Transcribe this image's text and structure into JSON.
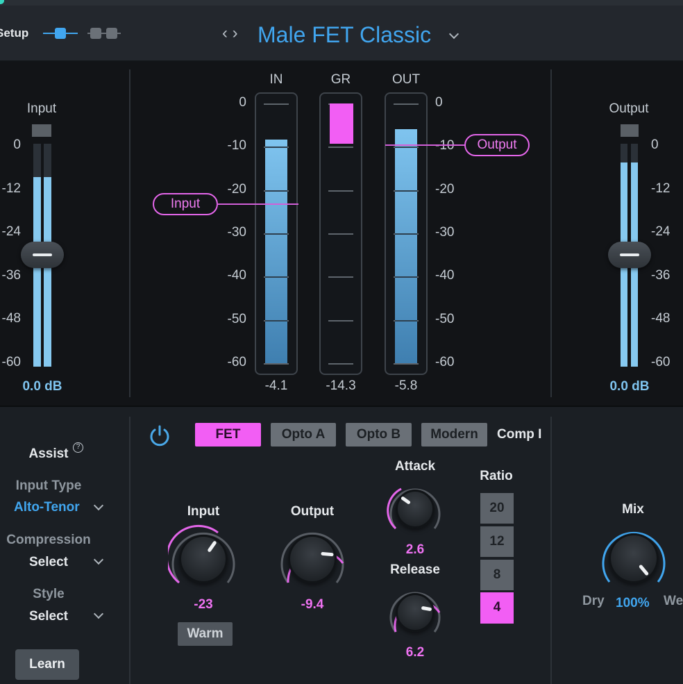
{
  "header": {
    "setup_label": "Setup",
    "nav_glyph": "‹ ›",
    "preset_name": "Male FET Classic",
    "icons": [
      "single-view-icon",
      "dual-view-icon",
      "chevron-down-icon"
    ]
  },
  "meters": {
    "input_fader": {
      "label": "Input",
      "value": "0.0 dB",
      "scale": [
        "0",
        "-12",
        "-24",
        "-36",
        "-48",
        "-60"
      ]
    },
    "output_fader": {
      "label": "Output",
      "value": "0.0 dB",
      "scale": [
        "0",
        "-12",
        "-24",
        "-36",
        "-48",
        "-60"
      ]
    },
    "columns": [
      {
        "label": "IN",
        "readout": "-4.1"
      },
      {
        "label": "GR",
        "readout": "-14.3"
      },
      {
        "label": "OUT",
        "readout": "-5.8"
      }
    ],
    "left_scale": [
      "0",
      "-10",
      "-20",
      "-30",
      "-40",
      "-50",
      "-60"
    ],
    "right_scale": [
      "0",
      "-10",
      "-20",
      "-30",
      "-40",
      "-50",
      "-60"
    ],
    "callouts": {
      "input": "Input",
      "output": "Output"
    },
    "levels": {
      "in": 0.86,
      "gr": 0.155,
      "out": 0.9,
      "input_fader": 0.85,
      "output_fader": 0.915
    },
    "colors": {
      "meter": "#7fc4ef",
      "accent": "#f25ef4",
      "brand": "#41a6ef"
    }
  },
  "assist": {
    "title": "Assist",
    "help_glyph": "?",
    "input_type_label": "Input Type",
    "input_type_value": "Alto-Tenor",
    "compression_label": "Compression",
    "compression_value": "Select",
    "style_label": "Style",
    "style_value": "Select",
    "learn_label": "Learn"
  },
  "comp": {
    "power_icon": "power-icon",
    "modes": [
      "FET",
      "Opto A",
      "Opto B",
      "Modern"
    ],
    "active_mode": "FET",
    "section_label": "Comp I",
    "input_label": "Input",
    "input_value": "-23",
    "warm_label": "Warm",
    "output_label": "Output",
    "output_value": "-9.4",
    "attack_label": "Attack",
    "attack_value": "2.6",
    "release_label": "Release",
    "release_value": "6.2",
    "ratio_label": "Ratio",
    "ratios": [
      "20",
      "12",
      "8",
      "4"
    ],
    "active_ratio": "4"
  },
  "mix": {
    "label": "Mix",
    "dry": "Dry",
    "value": "100%",
    "wet": "We"
  }
}
